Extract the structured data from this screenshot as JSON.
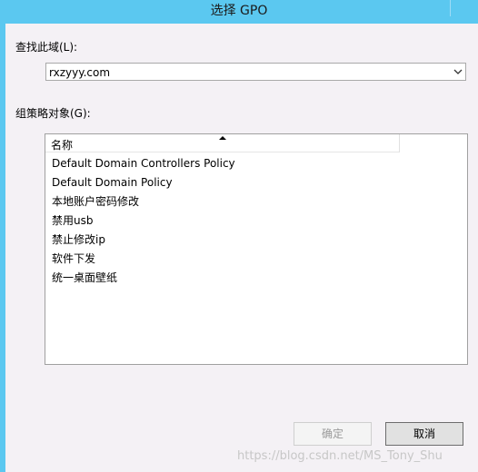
{
  "window": {
    "title": "选择 GPO",
    "close_icon": "close-icon"
  },
  "look_in": {
    "label": "查找此域(L):",
    "value": "rxzyyy.com"
  },
  "gpo_list": {
    "label": "组策略对象(G):",
    "column_header": "名称",
    "items": [
      "Default Domain Controllers Policy",
      "Default Domain Policy",
      "本地账户密码修改",
      "禁用usb",
      "禁止修改ip",
      "软件下发",
      "统一桌面壁纸"
    ]
  },
  "buttons": {
    "ok": "确定",
    "cancel": "取消"
  },
  "watermark": "https://blog.csdn.net/MS_Tony_Shu",
  "colors": {
    "titlebar": "#5bc8f0",
    "client_bg": "#f4f1f5"
  }
}
